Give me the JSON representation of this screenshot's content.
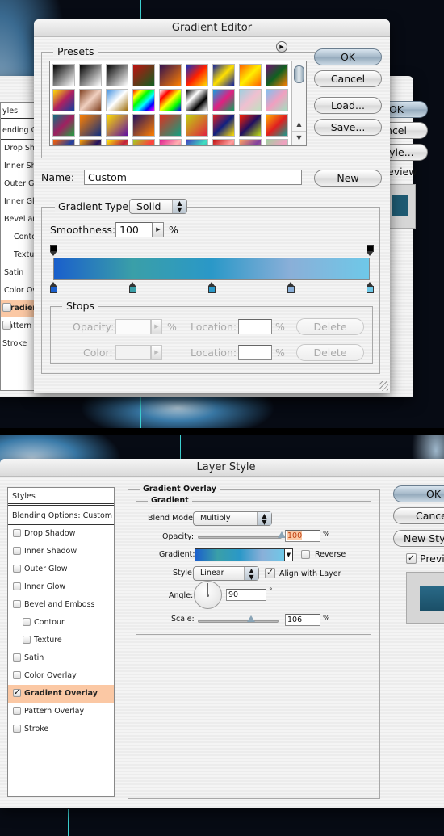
{
  "gradient_editor": {
    "title": "Gradient Editor",
    "presets_label": "Presets",
    "presets_menu_icon": "circle-arrow-right",
    "buttons": {
      "ok": "OK",
      "cancel": "Cancel",
      "load": "Load...",
      "save": "Save...",
      "new": "New"
    },
    "name_label": "Name:",
    "name_value": "Custom",
    "gradient_type_label": "Gradient Type:",
    "gradient_type_value": "Solid",
    "smoothness_label": "Smoothness:",
    "smoothness_value": "100",
    "smoothness_unit": "%",
    "gradient_colors": {
      "opacity_stops": [
        {
          "location_pct": 0,
          "color": "#000000"
        },
        {
          "location_pct": 100,
          "color": "#000000"
        }
      ],
      "color_stops": [
        {
          "location_pct": 0,
          "color": "#1a5fcc"
        },
        {
          "location_pct": 25,
          "color": "#3a9fa8"
        },
        {
          "location_pct": 50,
          "color": "#2a98c8"
        },
        {
          "location_pct": 75,
          "color": "#8aafd8"
        },
        {
          "location_pct": 100,
          "color": "#6ec8e8"
        }
      ]
    },
    "stops": {
      "title": "Stops",
      "opacity_label": "Opacity:",
      "opacity_value": "",
      "color_label": "Color:",
      "location_label": "Location:",
      "location_value_1": "",
      "location_value_2": "",
      "percent": "%",
      "delete_label": "Delete"
    }
  },
  "background_layer_style": {
    "buttons": {
      "ok": "OK",
      "cancel": "ncel",
      "new_style": "Style..."
    },
    "preview_label": "eview",
    "list": [
      "yles",
      "ending Opti",
      "Drop Sha",
      "Inner Sha",
      "Outer Glo",
      "Inner Glo",
      "Bevel and",
      "Contou",
      "Textur",
      "Satin",
      "Color Ove",
      "Gradient",
      "Pattern O",
      "Stroke"
    ]
  },
  "layer_style": {
    "title": "Layer Style",
    "styles_header": "Styles",
    "blending_options": "Blending Options: Custom",
    "effects": [
      {
        "label": "Drop Shadow",
        "checked": false,
        "indent": false
      },
      {
        "label": "Inner Shadow",
        "checked": false,
        "indent": false
      },
      {
        "label": "Outer Glow",
        "checked": false,
        "indent": false
      },
      {
        "label": "Inner Glow",
        "checked": false,
        "indent": false
      },
      {
        "label": "Bevel and Emboss",
        "checked": false,
        "indent": false
      },
      {
        "label": "Contour",
        "checked": false,
        "indent": true
      },
      {
        "label": "Texture",
        "checked": false,
        "indent": true
      },
      {
        "label": "Satin",
        "checked": false,
        "indent": false
      },
      {
        "label": "Color Overlay",
        "checked": false,
        "indent": false
      },
      {
        "label": "Gradient Overlay",
        "checked": true,
        "indent": false,
        "selected": true
      },
      {
        "label": "Pattern Overlay",
        "checked": false,
        "indent": false
      },
      {
        "label": "Stroke",
        "checked": false,
        "indent": false
      }
    ],
    "section_title": "Gradient Overlay",
    "subsection_title": "Gradient",
    "blend_mode_label": "Blend Mode:",
    "blend_mode_value": "Multiply",
    "opacity_label": "Opacity:",
    "opacity_value": "100",
    "opacity_level_pct": 100,
    "percent": "%",
    "gradient_label": "Gradient:",
    "reverse_label": "Reverse",
    "reverse_checked": false,
    "style_label": "Style:",
    "style_value": "Linear",
    "align_label": "Align with Layer",
    "align_checked": true,
    "angle_label": "Angle:",
    "angle_value": "90",
    "degree": "°",
    "scale_label": "Scale:",
    "scale_value": "106",
    "scale_level_pct": 66,
    "buttons": {
      "ok": "OK",
      "cancel": "Cance",
      "new_style": "New Sty"
    },
    "preview_label": "Previ",
    "preview_checked": true,
    "preview_color": "#1e5a72",
    "highlight_color": "#fbc8a4"
  }
}
